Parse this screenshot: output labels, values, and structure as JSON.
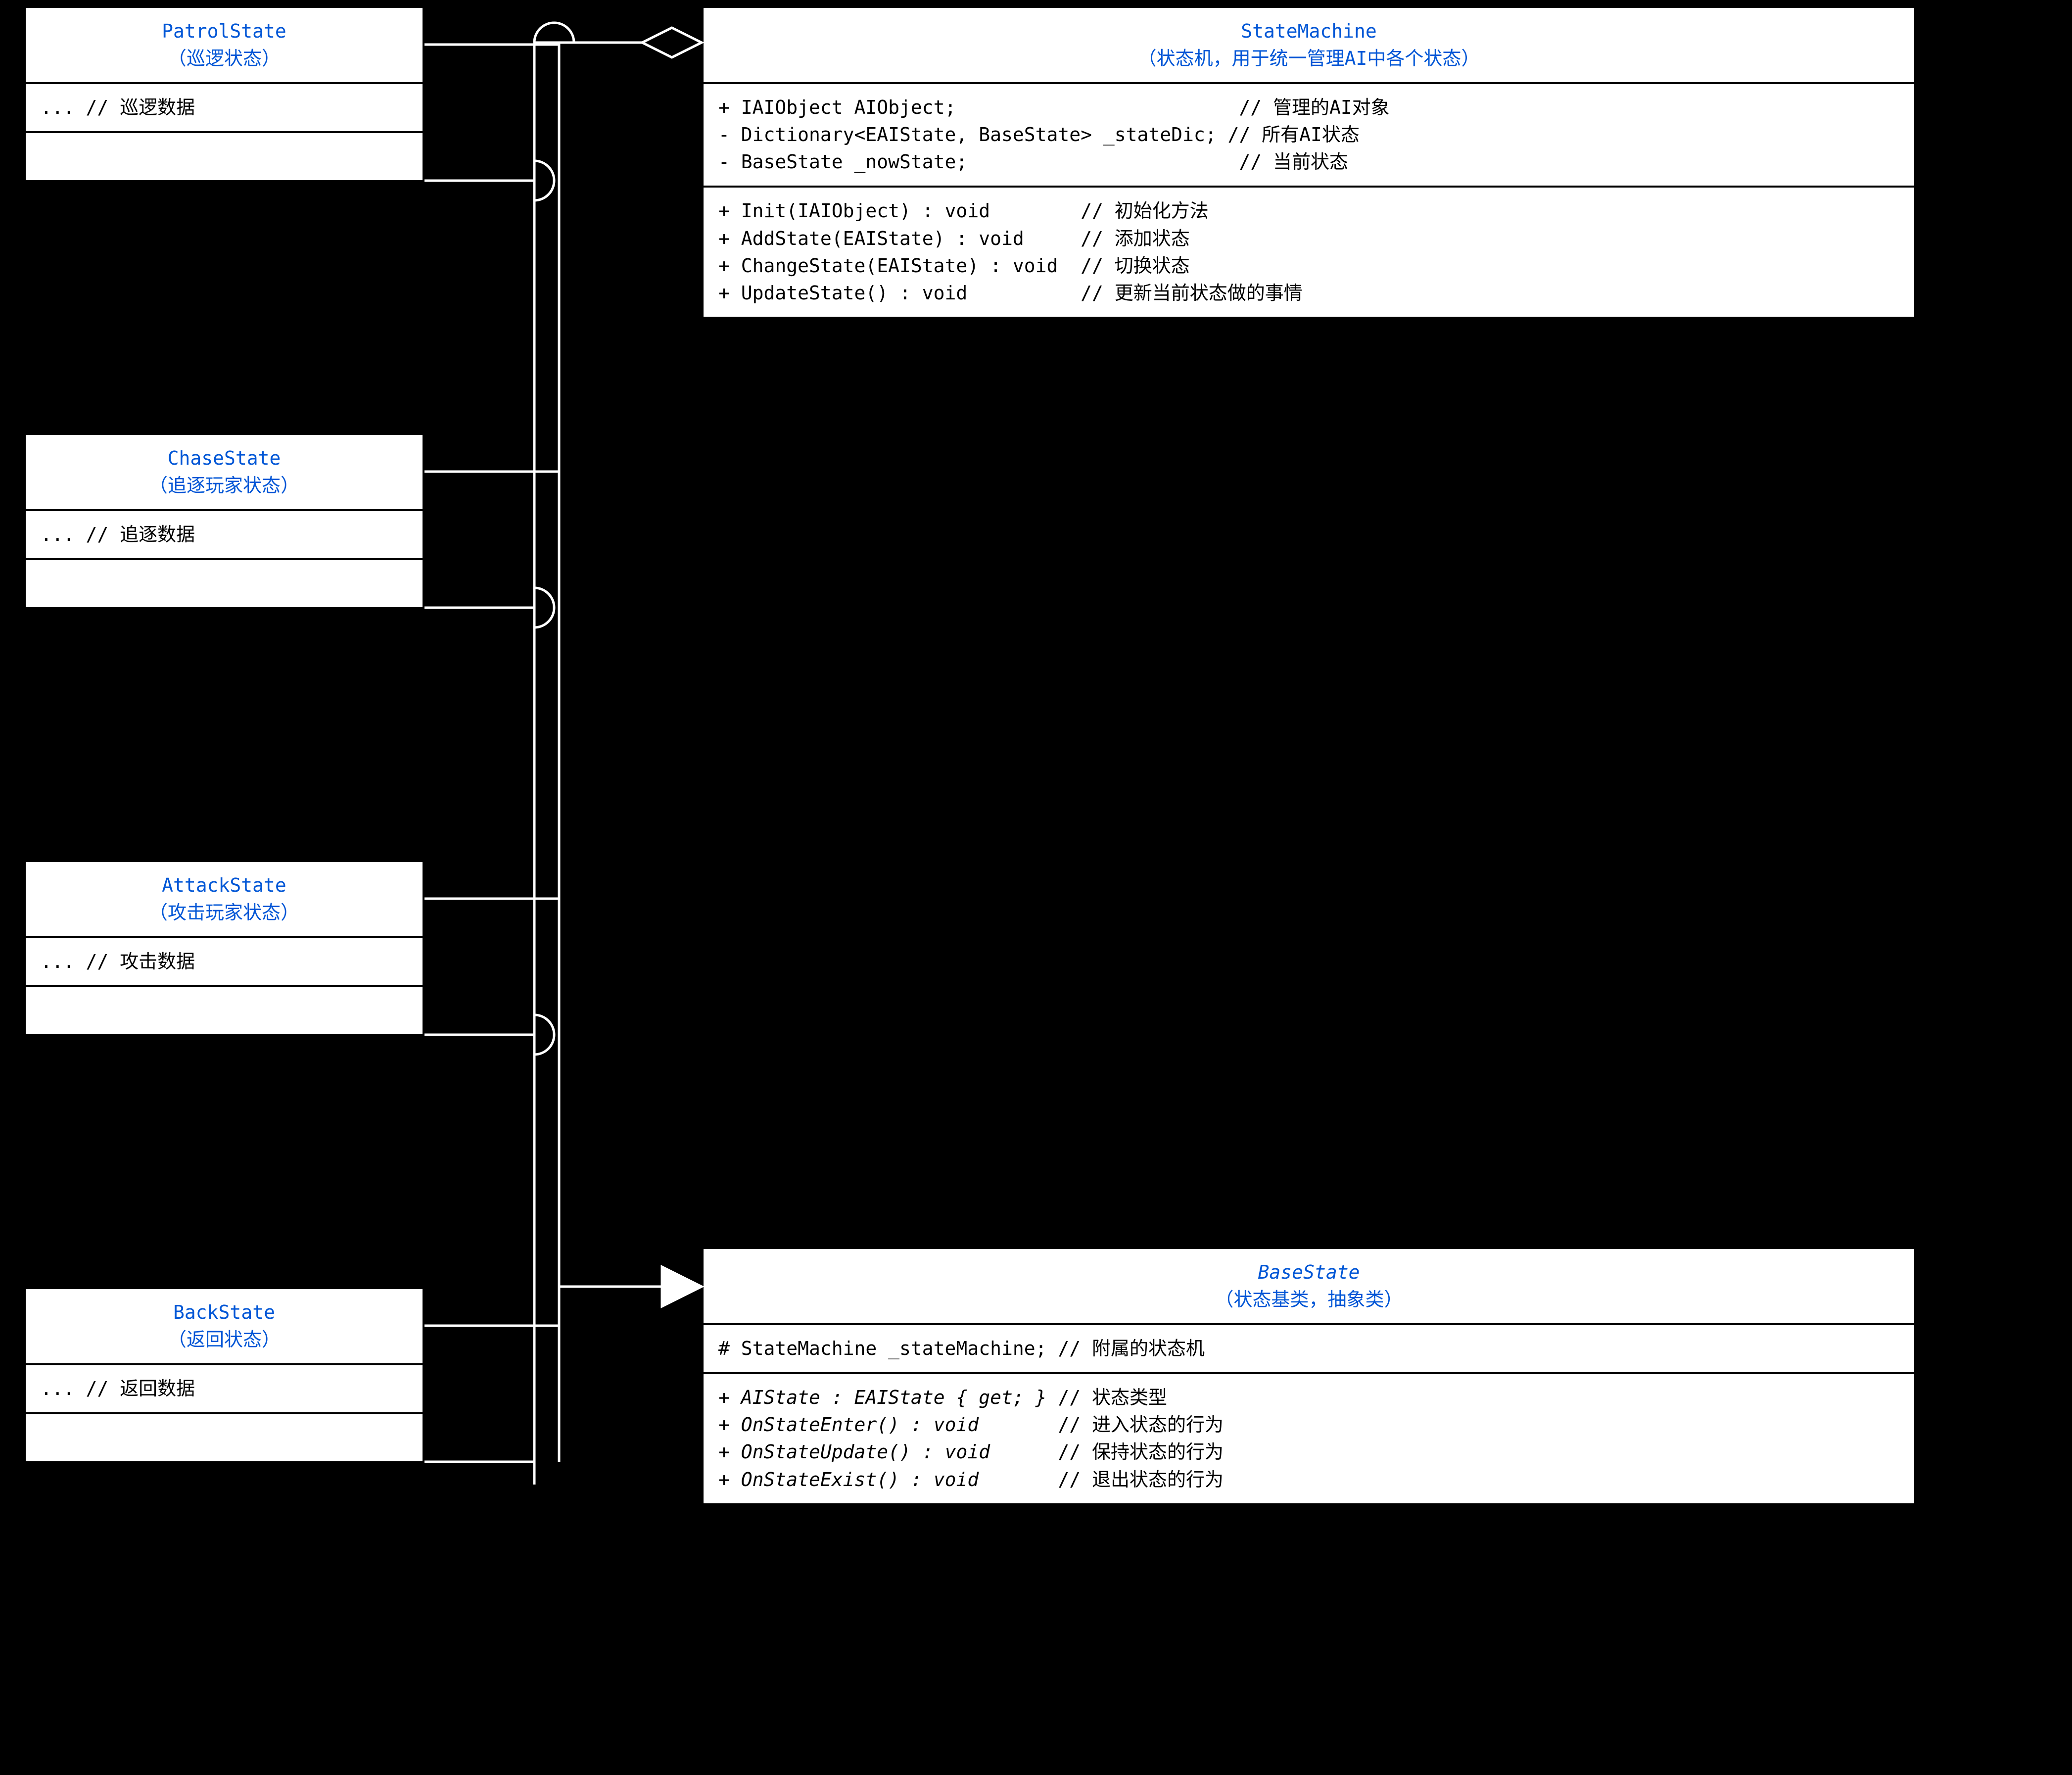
{
  "stateMachine": {
    "name": "StateMachine",
    "subtitle": "（状态机，用于统一管理AI中各个状态）",
    "fields": "+ IAIObject AIObject;                         // 管理的AI对象\n- Dictionary<EAIState, BaseState> _stateDic; // 所有AI状态\n- BaseState _nowState;                        // 当前状态",
    "methods": "+ Init(IAIObject) : void        // 初始化方法\n+ AddState(EAIState) : void     // 添加状态\n+ ChangeState(EAIState) : void  // 切换状态\n+ UpdateState() : void          // 更新当前状态做的事情"
  },
  "baseState": {
    "name": "BaseState",
    "subtitle": "（状态基类，抽象类）",
    "fields": "# StateMachine _stateMachine; // 附属的状态机",
    "methods_html": "+ <span class=\"italic-line\">AIState : EAIState { get; }</span> // 状态类型\n+ <span class=\"italic-line\">OnStateEnter() : void</span>       // 进入状态的行为\n+ <span class=\"italic-line\">OnStateUpdate() : void</span>      // 保持状态的行为\n+ <span class=\"italic-line\">OnStateExist() : void</span>       // 退出状态的行为"
  },
  "patrol": {
    "name": "PatrolState",
    "subtitle": "（巡逻状态）",
    "fields": "... // 巡逻数据",
    "methods": " "
  },
  "chase": {
    "name": "ChaseState",
    "subtitle": "（追逐玩家状态）",
    "fields": "... // 追逐数据",
    "methods": " "
  },
  "attack": {
    "name": "AttackState",
    "subtitle": "（攻击玩家状态）",
    "fields": "... // 攻击数据",
    "methods": " "
  },
  "back": {
    "name": "BackState",
    "subtitle": "（返回状态）",
    "fields": "... // 返回数据",
    "methods": " "
  }
}
